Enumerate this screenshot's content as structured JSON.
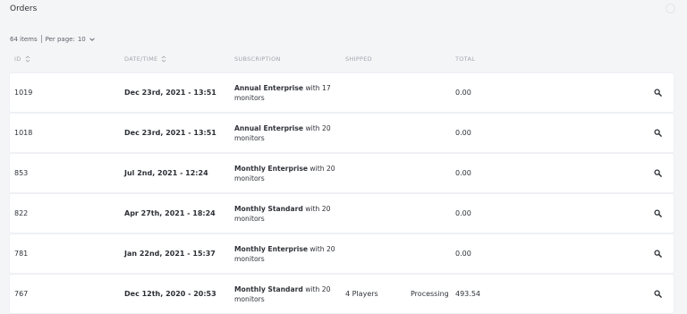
{
  "page": {
    "title": "Orders"
  },
  "meta": {
    "items_count": "64 items",
    "per_page_label": "Per page:",
    "per_page_value": "10"
  },
  "columns": {
    "id": "ID",
    "datetime": "DATE/TIME",
    "subscription": "SUBSCRIPTION",
    "shipped": "SHIPPED",
    "total": "TOTAL"
  },
  "orders": [
    {
      "id": "1019",
      "datetime": "Dec 23rd, 2021 - 13:51",
      "plan": "Annual Enterprise",
      "with_text": "with 17",
      "monitors": "monitors",
      "shipped": "",
      "status": "",
      "total": "0.00"
    },
    {
      "id": "1018",
      "datetime": "Dec 23rd, 2021 - 13:51",
      "plan": "Annual Enterprise",
      "with_text": "with 20",
      "monitors": "monitors",
      "shipped": "",
      "status": "",
      "total": "0.00"
    },
    {
      "id": "853",
      "datetime": "Jul 2nd, 2021 - 12:24",
      "plan": "Monthly Enterprise",
      "with_text": "with 20",
      "monitors": "monitors",
      "shipped": "",
      "status": "",
      "total": "0.00"
    },
    {
      "id": "822",
      "datetime": "Apr 27th, 2021 - 18:24",
      "plan": "Monthly Standard",
      "with_text": "with 20",
      "monitors": "monitors",
      "shipped": "",
      "status": "",
      "total": "0.00"
    },
    {
      "id": "781",
      "datetime": "Jan 22nd, 2021 - 15:37",
      "plan": "Monthly Enterprise",
      "with_text": "with 20",
      "monitors": "monitors",
      "shipped": "",
      "status": "",
      "total": "0.00"
    },
    {
      "id": "767",
      "datetime": "Dec 12th, 2020 - 20:53",
      "plan": "Monthly Standard",
      "with_text": "with 20",
      "monitors": "monitors",
      "shipped": "4 Players",
      "status": "Processing",
      "total": "493.54"
    }
  ],
  "icons": {
    "sort": "sort-icon",
    "view": "search-icon",
    "dropdown": "chevron-down-icon"
  },
  "colors": {
    "background": "#f4f5f7",
    "row": "#ffffff",
    "header_text": "#a1a6ae"
  }
}
